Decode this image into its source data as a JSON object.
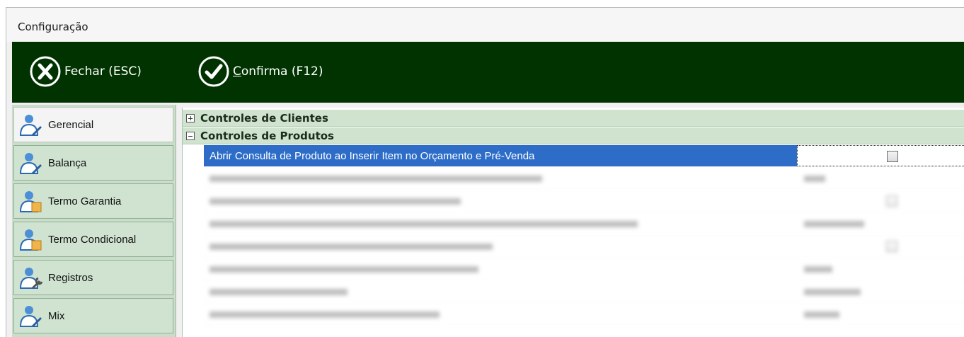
{
  "window": {
    "title": "Configuração"
  },
  "toolbar": {
    "close_label": "Fechar (ESC)",
    "confirm_label": "Confirma (F12)",
    "confirm_mnemonic": "C",
    "confirm_rest": "onfirma (F12)",
    "background": "#003300"
  },
  "sidebar": {
    "items": [
      {
        "label": "Gerencial",
        "icon": "user-edit-icon",
        "active": true
      },
      {
        "label": "Balança",
        "icon": "user-edit-icon",
        "active": false
      },
      {
        "label": "Termo Garantia",
        "icon": "user-document-icon",
        "active": false
      },
      {
        "label": "Termo Condicional",
        "icon": "user-document-icon",
        "active": false
      },
      {
        "label": "Registros",
        "icon": "user-wrench-icon",
        "active": false
      },
      {
        "label": "Mix",
        "icon": "user-edit-icon",
        "active": false
      }
    ]
  },
  "grid": {
    "categories": [
      {
        "title": "Controles de Clientes",
        "expanded": false
      },
      {
        "title": "Controles de Produtos",
        "expanded": true
      }
    ],
    "selected_row": {
      "label": "Abrir Consulta de Produto ao Inserir Item no Orçamento e Pré-Venda",
      "checked": false
    }
  },
  "colors": {
    "selection": "#2d6dc8",
    "category_bg": "#cfe3cf",
    "sidebar_bg": "#c9ddca"
  }
}
